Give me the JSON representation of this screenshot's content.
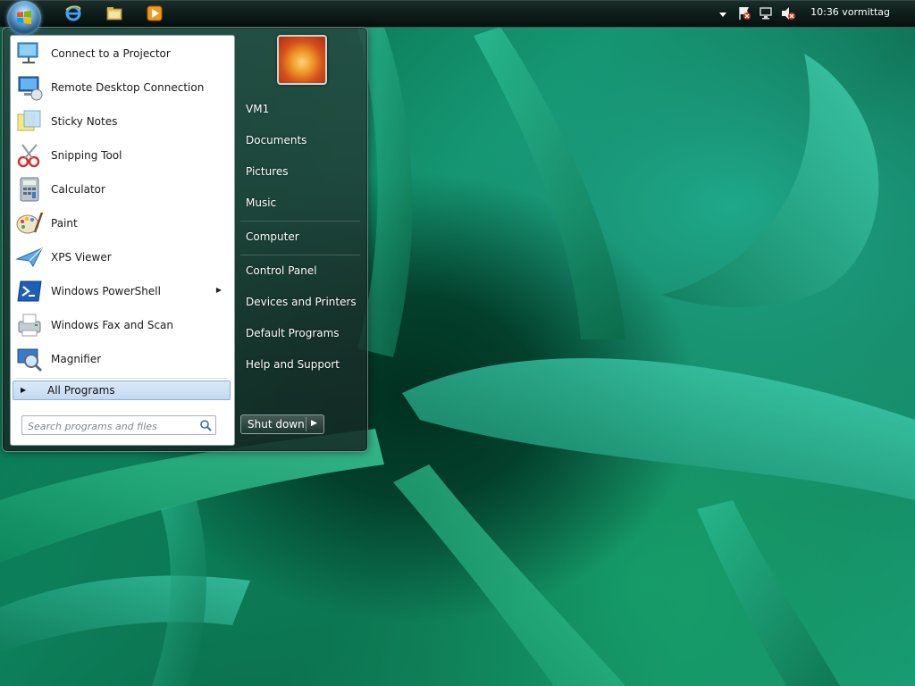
{
  "taskbar": {
    "clock": "10:36 vormittag",
    "pinned": [
      "internet-explorer-icon",
      "windows-explorer-icon",
      "media-player-icon"
    ],
    "tray": [
      "show-hidden-icons-icon",
      "action-center-icon",
      "network-icon",
      "volume-muted-icon"
    ]
  },
  "start_menu": {
    "programs": [
      {
        "label": "Connect to a Projector",
        "icon": "projector-icon"
      },
      {
        "label": "Remote Desktop Connection",
        "icon": "remote-desktop-icon"
      },
      {
        "label": "Sticky Notes",
        "icon": "sticky-notes-icon"
      },
      {
        "label": "Snipping Tool",
        "icon": "snipping-tool-icon"
      },
      {
        "label": "Calculator",
        "icon": "calculator-icon"
      },
      {
        "label": "Paint",
        "icon": "paint-icon"
      },
      {
        "label": "XPS Viewer",
        "icon": "xps-viewer-icon"
      },
      {
        "label": "Windows PowerShell",
        "icon": "powershell-icon",
        "has_submenu": true
      },
      {
        "label": "Windows Fax and Scan",
        "icon": "fax-scan-icon"
      },
      {
        "label": "Magnifier",
        "icon": "magnifier-icon"
      }
    ],
    "all_programs": "All Programs",
    "search": {
      "placeholder": "Search programs and files"
    },
    "right_links": [
      {
        "label": "VM1"
      },
      {
        "label": "Documents"
      },
      {
        "label": "Pictures"
      },
      {
        "label": "Music"
      },
      {
        "label": "Computer"
      },
      {
        "label": "Control Panel"
      },
      {
        "label": "Devices and Printers"
      },
      {
        "label": "Default Programs"
      },
      {
        "label": "Help and Support"
      }
    ],
    "shutdown_label": "Shut down"
  }
}
